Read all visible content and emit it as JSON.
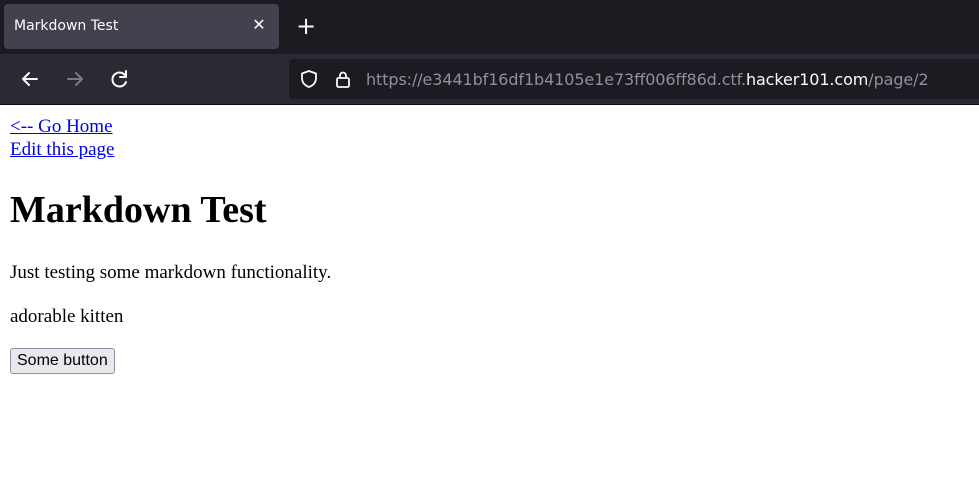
{
  "browser": {
    "tab_title": "Markdown Test",
    "tab_close_icon": "close-icon",
    "new_tab_icon": "plus-icon",
    "url_prefix": "https://e3441bf16df1b4105e1e73ff006ff86d.ctf.",
    "url_host": "hacker101.com",
    "url_path": "/page/2"
  },
  "page": {
    "go_home_link": "<-- Go Home",
    "edit_link": "Edit this page",
    "heading": "Markdown Test",
    "intro": "Just testing some markdown functionality.",
    "image_alt": "adorable kitten",
    "button_label": "Some button"
  },
  "colors": {
    "tabbar_bg": "#1c1b22",
    "active_tab_bg": "#42414d",
    "navbar_bg": "#2b2a33",
    "link": "#0000ee"
  }
}
